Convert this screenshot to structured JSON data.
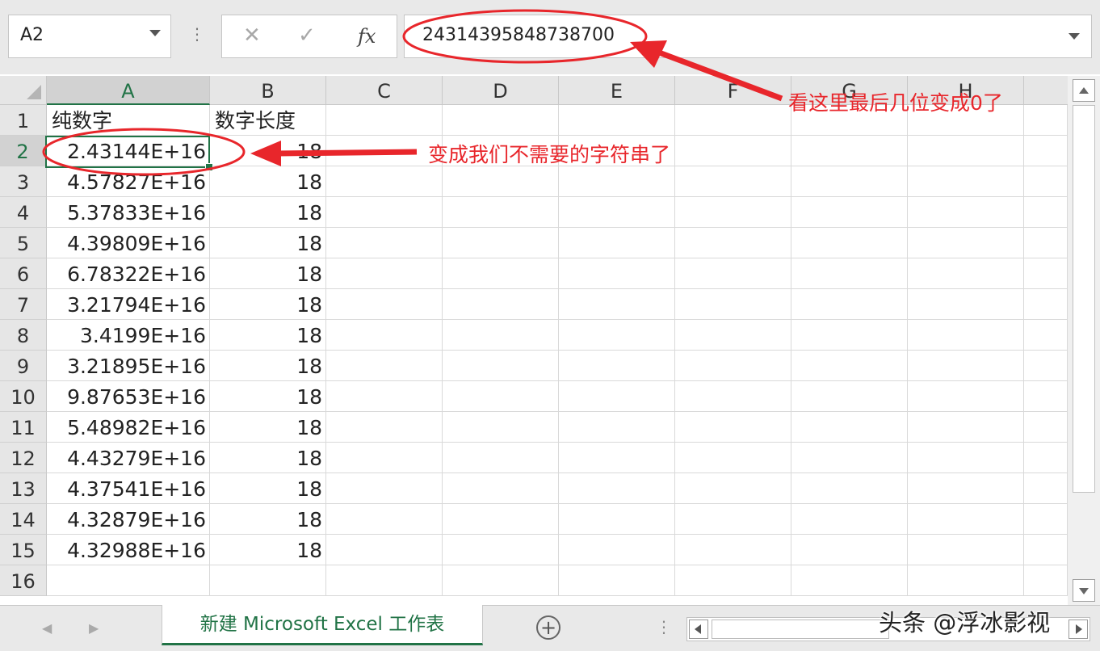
{
  "formula_bar": {
    "name_box": "A2",
    "cancel_icon": "✕",
    "enter_icon": "✓",
    "insert_function_label": "fx",
    "formula_value": "24314395848738700"
  },
  "columns": [
    "A",
    "B",
    "C",
    "D",
    "E",
    "F",
    "G",
    "H"
  ],
  "rows": [
    {
      "num": "1",
      "a": "纯数字",
      "b": "数字长度"
    },
    {
      "num": "2",
      "a": "2.43144E+16",
      "b": "18"
    },
    {
      "num": "3",
      "a": "4.57827E+16",
      "b": "18"
    },
    {
      "num": "4",
      "a": "5.37833E+16",
      "b": "18"
    },
    {
      "num": "5",
      "a": "4.39809E+16",
      "b": "18"
    },
    {
      "num": "6",
      "a": "6.78322E+16",
      "b": "18"
    },
    {
      "num": "7",
      "a": "3.21794E+16",
      "b": "18"
    },
    {
      "num": "8",
      "a": "3.4199E+16",
      "b": "18"
    },
    {
      "num": "9",
      "a": "3.21895E+16",
      "b": "18"
    },
    {
      "num": "10",
      "a": "9.87653E+16",
      "b": "18"
    },
    {
      "num": "11",
      "a": "5.48982E+16",
      "b": "18"
    },
    {
      "num": "12",
      "a": "4.43279E+16",
      "b": "18"
    },
    {
      "num": "13",
      "a": "4.37541E+16",
      "b": "18"
    },
    {
      "num": "14",
      "a": "4.32879E+16",
      "b": "18"
    },
    {
      "num": "15",
      "a": "4.32988E+16",
      "b": "18"
    },
    {
      "num": "16",
      "a": "",
      "b": ""
    }
  ],
  "selected_cell": "A2",
  "sheet_tab": {
    "label": "新建 Microsoft Excel 工作表",
    "add_icon": "+"
  },
  "annotations": {
    "formula_note": "看这里最后几位变成0了",
    "cell_note": "变成我们不需要的字符串了",
    "color": "#e8262b"
  },
  "watermark": "头条 @浮冰影视",
  "colors": {
    "excel_green": "#217346",
    "header_bg": "#e6e6e6",
    "gridline": "#d9d9d9"
  },
  "icons": [
    "dropdown-arrow-icon",
    "cancel-icon",
    "enter-check-icon",
    "function-icon",
    "add-sheet-icon",
    "scroll-arrow-icon"
  ]
}
